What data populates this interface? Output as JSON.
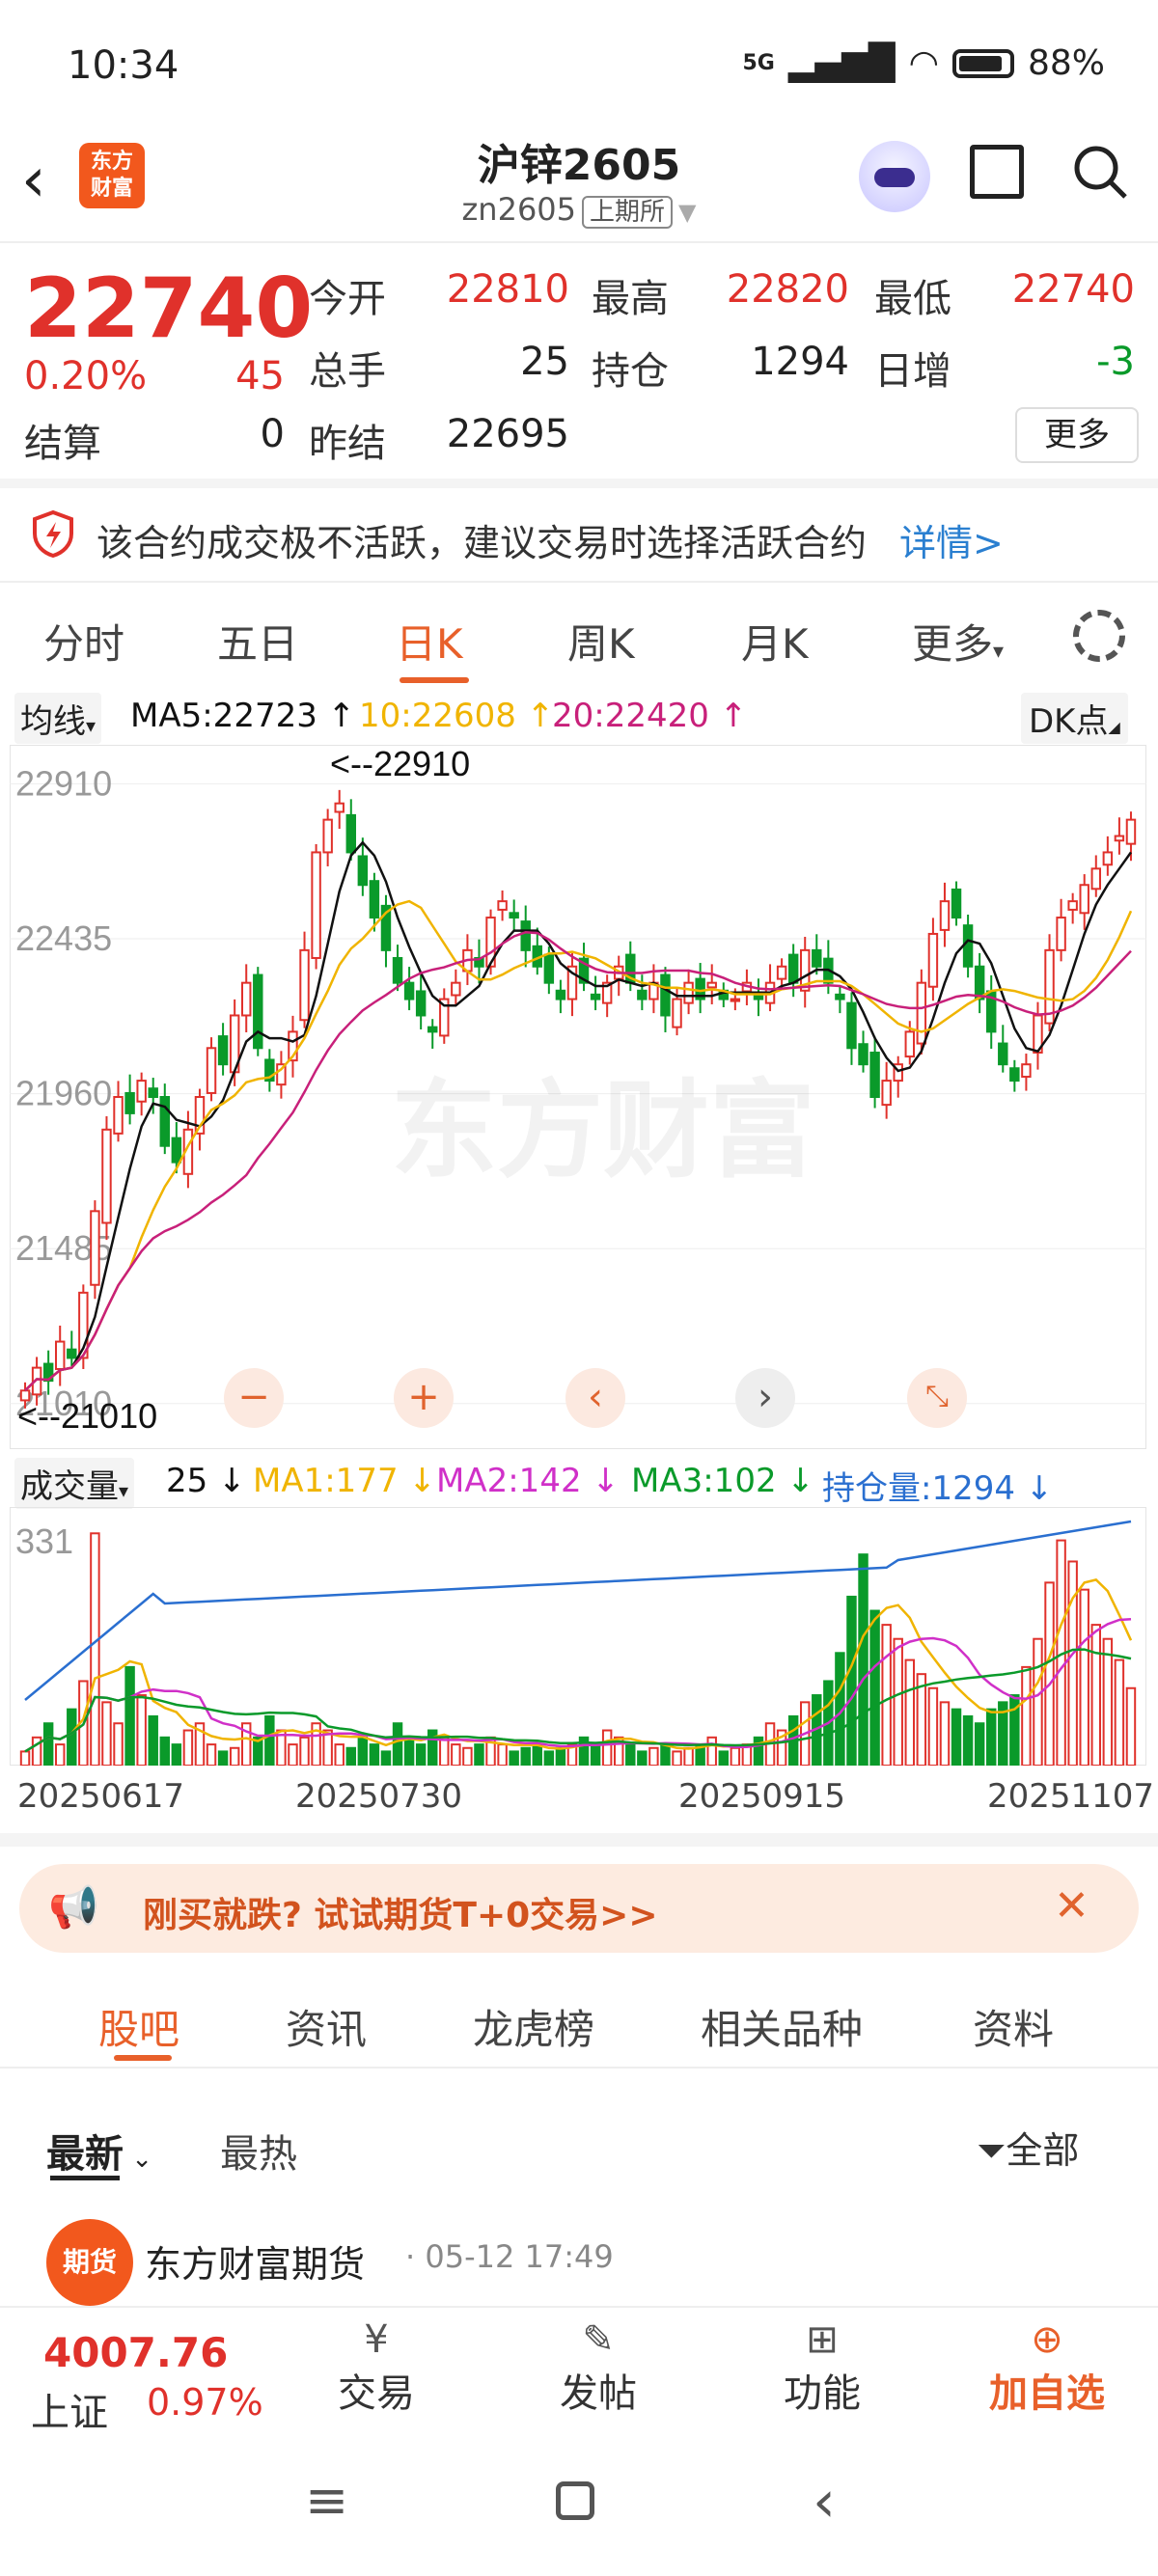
{
  "status_bar": {
    "time": "10:34",
    "network": "5G",
    "battery": "88%"
  },
  "header": {
    "logo_line1": "东方",
    "logo_line2": "财富",
    "title": "沪锌2605",
    "code": "zn2605",
    "exchange": "上期所"
  },
  "quote": {
    "price": "22740",
    "change_pct": "0.20%",
    "change": "45",
    "open_label": "今开",
    "open": "22810",
    "high_label": "最高",
    "high": "22820",
    "low_label": "最低",
    "low": "22740",
    "volume_label": "总手",
    "volume": "25",
    "oi_label": "持仓",
    "oi": "1294",
    "daily_inc_label": "日增",
    "daily_inc": "-3",
    "settle_label": "结算",
    "settle": "0",
    "prev_settle_label": "昨结",
    "prev_settle": "22695",
    "more_label": "更多"
  },
  "warning": {
    "text": "该合约成交极不活跃，建议交易时选择活跃合约",
    "link": "详情>"
  },
  "chart_tabs": [
    "分时",
    "五日",
    "日K",
    "周K",
    "月K",
    "更多"
  ],
  "ma_row": {
    "selector": "均线",
    "ma5": "MA5:22723",
    "ma10": "10:22608",
    "ma20": "20:22420",
    "dk": "DK点"
  },
  "colors": {
    "up": "#e0312b",
    "down": "#0a9a2a",
    "ma5": "#111111",
    "ma10": "#f0b400",
    "ma20": "#c8207a",
    "accent": "#e8602a",
    "oi_line": "#2a6fd0"
  },
  "chart_data": {
    "type": "candlestick",
    "y_ticks": [
      "22910",
      "22435",
      "21960",
      "21485",
      "21010"
    ],
    "ylim": [
      20900,
      23000
    ],
    "high_marker": "<--22910",
    "low_marker": "<--21010",
    "watermark": "东方财富",
    "x_labels": [
      "20250617",
      "20250730",
      "20250915",
      "20251107"
    ],
    "closes": [
      21050,
      21120,
      21080,
      21200,
      21150,
      21350,
      21600,
      21850,
      21950,
      21900,
      22000,
      21950,
      21800,
      21750,
      21850,
      21950,
      22100,
      22050,
      22200,
      22300,
      22100,
      22000,
      22050,
      22150,
      22400,
      22700,
      22800,
      22850,
      22700,
      22600,
      22500,
      22400,
      22300,
      22250,
      22200,
      22150,
      22250,
      22300,
      22400,
      22350,
      22500,
      22550,
      22500,
      22400,
      22350,
      22300,
      22250,
      22350,
      22300,
      22250,
      22300,
      22350,
      22300,
      22250,
      22300,
      22200,
      22250,
      22300,
      22250,
      22300,
      22250,
      22250,
      22300,
      22250,
      22300,
      22350,
      22300,
      22400,
      22350,
      22300,
      22250,
      22100,
      22050,
      21950,
      22000,
      22050,
      22150,
      22300,
      22450,
      22550,
      22500,
      22350,
      22250,
      22150,
      22050,
      22000,
      22050,
      22200,
      22400,
      22500,
      22550,
      22600,
      22650,
      22700,
      22750,
      22800
    ],
    "vol_ylabel": "331",
    "vol_bars": [
      20,
      40,
      60,
      30,
      80,
      120,
      330,
      90,
      60,
      140,
      100,
      70,
      40,
      30,
      50,
      60,
      30,
      20,
      25,
      60,
      40,
      70,
      50,
      30,
      40,
      60,
      50,
      30,
      25,
      40,
      30,
      20,
      60,
      40,
      30,
      50,
      40,
      30,
      25,
      30,
      40,
      30,
      20,
      25,
      30,
      20,
      25,
      30,
      40,
      30,
      50,
      40,
      30,
      20,
      25,
      30,
      20,
      25,
      30,
      40,
      20,
      25,
      30,
      40,
      60,
      50,
      70,
      90,
      100,
      120,
      160,
      240,
      300,
      220,
      200,
      180,
      150,
      130,
      110,
      90,
      80,
      70,
      60,
      80,
      90,
      100,
      140,
      180,
      260,
      320,
      290,
      250,
      200,
      180,
      150,
      110
    ],
    "vol_ma1": "MA1:177",
    "vol_ma2": "MA2:142",
    "vol_ma3": "MA3:102",
    "oi": "持仓量:1294"
  },
  "vol_row": {
    "selector": "成交量",
    "value": "25"
  },
  "promo": {
    "text": "刚买就跌? 试试期货T+0交易>>"
  },
  "sub_tabs": [
    "股吧",
    "资讯",
    "龙虎榜",
    "相关品种",
    "资料"
  ],
  "sort": {
    "latest": "最新",
    "hot": "最热",
    "filter": "全部"
  },
  "post": {
    "author": "东方财富期货",
    "time": "05-12 17:49",
    "avatar_text": "期货"
  },
  "bottom": {
    "index_value": "4007.76",
    "index_name": "上证",
    "index_change": "0.97%",
    "trade": "交易",
    "post": "发帖",
    "functions": "功能",
    "add_watch": "加自选"
  }
}
